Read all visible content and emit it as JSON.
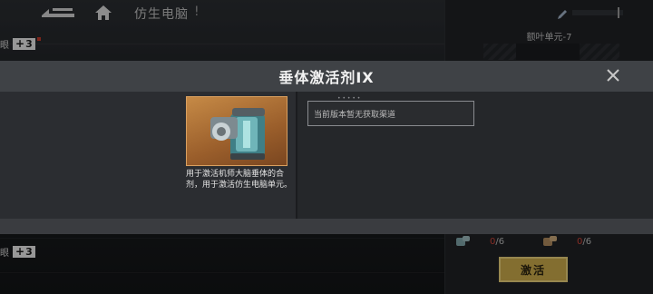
{
  "topbar": {
    "title": "仿生电脑",
    "alert": "!"
  },
  "side_chips": [
    {
      "label": "眼",
      "plus": "+",
      "value": "3"
    },
    {
      "label": "眼",
      "plus": "+",
      "value": "3"
    }
  ],
  "right_panel": {
    "unit_title": "额叶单元-7",
    "requirements": [
      {
        "count": "0",
        "total": "/6"
      },
      {
        "count": "0",
        "total": "/6"
      }
    ],
    "activate_label": "激活"
  },
  "modal": {
    "title": "垂体激活剂IX",
    "close_icon": "close-icon",
    "item_description": "用于激活机师大脑垂体的合剂，用于激活仿生电脑单元。",
    "source_text": "当前版本暂无获取渠道",
    "source_dots": "• • • • •"
  },
  "colors": {
    "accent_gold": "#c9a94a",
    "alert_red": "#d0453a",
    "item_bg": "#b07438"
  }
}
